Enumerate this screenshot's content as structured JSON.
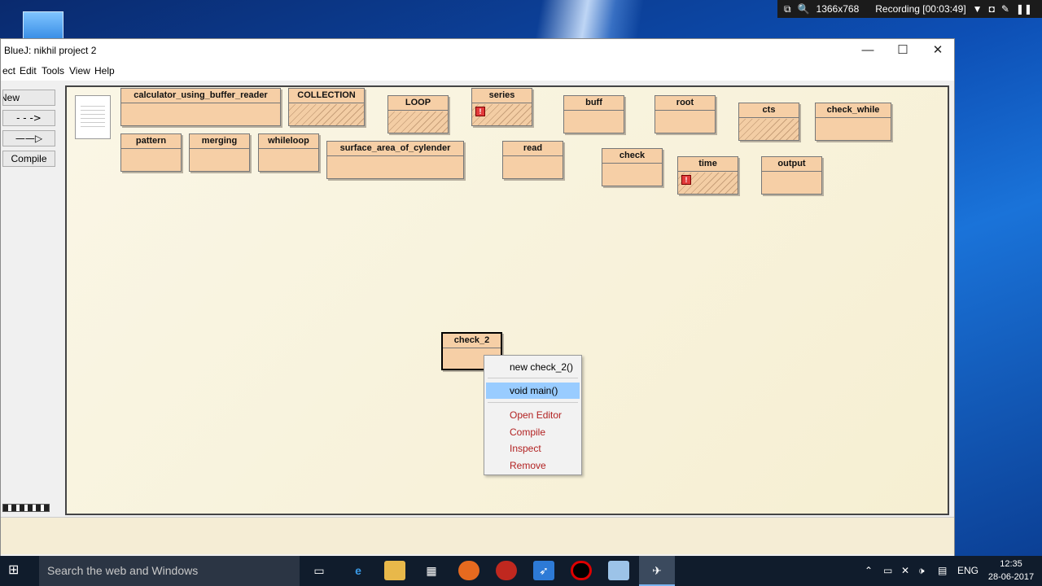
{
  "recorder": {
    "resolution": "1366x768",
    "status": "Recording [00:03:49]"
  },
  "window": {
    "title": "BlueJ:  nikhil project 2"
  },
  "menu": [
    "ect",
    "Edit",
    "Tools",
    "View",
    "Help"
  ],
  "sidebar": {
    "new_class": "New Class...",
    "compile": "Compile"
  },
  "classes": [
    {
      "name": "calculator_using_buffer_reader"
    },
    {
      "name": "COLLECTION"
    },
    {
      "name": "LOOP"
    },
    {
      "name": "series"
    },
    {
      "name": "buff"
    },
    {
      "name": "root"
    },
    {
      "name": "cts"
    },
    {
      "name": "check_while"
    },
    {
      "name": "pattern"
    },
    {
      "name": "merging"
    },
    {
      "name": "whileloop"
    },
    {
      "name": "surface_area_of_cylender"
    },
    {
      "name": "read"
    },
    {
      "name": "check"
    },
    {
      "name": "time"
    },
    {
      "name": "output"
    },
    {
      "name": "check_2"
    }
  ],
  "context_menu": {
    "constructor": "new check_2()",
    "method": "void main()",
    "open_editor": "Open Editor",
    "compile": "Compile",
    "inspect": "Inspect",
    "remove": "Remove"
  },
  "taskbar": {
    "search_placeholder": "Search the web and Windows",
    "lang": "ENG",
    "time": "12:35",
    "date": "28-06-2017"
  }
}
